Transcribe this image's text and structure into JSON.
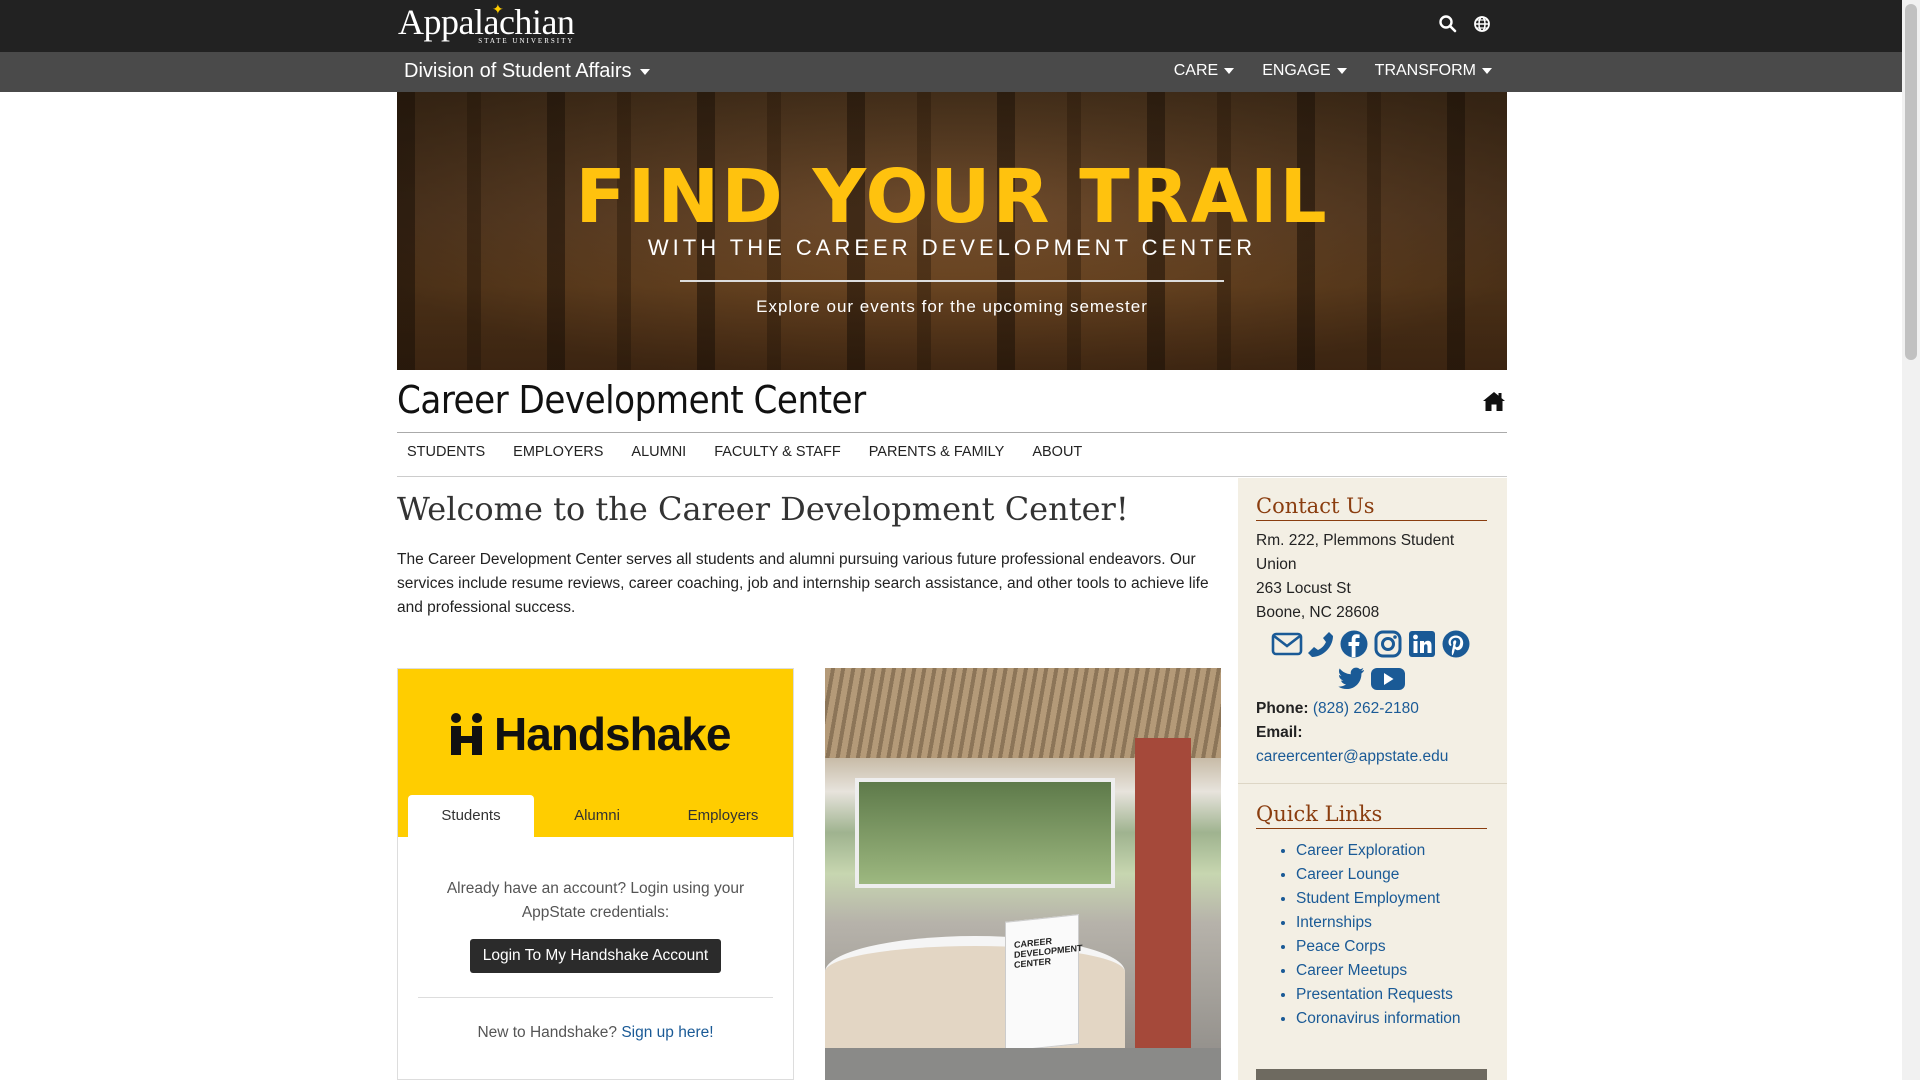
{
  "colors": {
    "topbar": "#222222",
    "division_bar": "#4a4a4a",
    "gold": "#FFC20E",
    "handshake_yellow": "#FFCD00",
    "link_blue": "#1a5a96",
    "sidebar_bg": "#f3efe4",
    "sidebar_heading": "#8a3d0f"
  },
  "header": {
    "logo_text": "Appalachian",
    "logo_sub": "STATE UNIVERSITY",
    "icons": [
      "search-icon",
      "globe-icon"
    ]
  },
  "division": {
    "title": "Division of Student Affairs",
    "nav": [
      {
        "label": "CARE"
      },
      {
        "label": "ENGAGE"
      },
      {
        "label": "TRANSFORM"
      }
    ]
  },
  "banner": {
    "title": "FIND YOUR TRAIL",
    "subtitle": "WITH THE CAREER DEVELOPMENT CENTER",
    "cta": "Explore our events for the upcoming semester"
  },
  "site": {
    "title": "Career Development Center",
    "home_icon": "home-icon",
    "nav": [
      {
        "label": "STUDENTS"
      },
      {
        "label": "EMPLOYERS"
      },
      {
        "label": "ALUMNI"
      },
      {
        "label": "FACULTY & STAFF"
      },
      {
        "label": "PARENTS & FAMILY"
      },
      {
        "label": "ABOUT"
      }
    ]
  },
  "main": {
    "heading": "Welcome to the Career Development Center!",
    "intro": "The Career Development Center serves all students and alumni pursuing various future professional endeavors. Our services include resume reviews, career coaching, job and internship search assistance, and other tools to achieve life and professional success."
  },
  "handshake": {
    "brand": "Handshake",
    "tabs": [
      {
        "label": "Students",
        "active": true
      },
      {
        "label": "Alumni",
        "active": false
      },
      {
        "label": "Employers",
        "active": false
      }
    ],
    "login_text": "Already have an account? Login using your AppState credentials:",
    "login_button": "Login To My Handshake Account",
    "new_text": "New to Handshake?",
    "signup_link": "Sign up here!"
  },
  "photo": {
    "sign_text": "CAREER DEVELOPMENT CENTER"
  },
  "sidebar": {
    "contact_heading": "Contact Us",
    "address_lines": [
      "Rm. 222, Plemmons Student Union",
      "263 Locust St",
      "Boone, NC 28608"
    ],
    "social_icons": [
      "envelope-icon",
      "phone-icon",
      "facebook-icon",
      "instagram-icon",
      "linkedin-icon",
      "pinterest-icon",
      "twitter-icon",
      "youtube-icon"
    ],
    "phone_label": "Phone:",
    "phone_value": "(828) 262-2180",
    "email_label": "Email:",
    "email_value": "careercenter@appstate.edu",
    "quick_heading": "Quick Links",
    "quick_links": [
      "Career Exploration",
      "Career Lounge",
      "Student Employment",
      "Internships",
      "Peace Corps",
      "Career Meetups",
      "Presentation Requests",
      "Coronavirus information"
    ]
  }
}
